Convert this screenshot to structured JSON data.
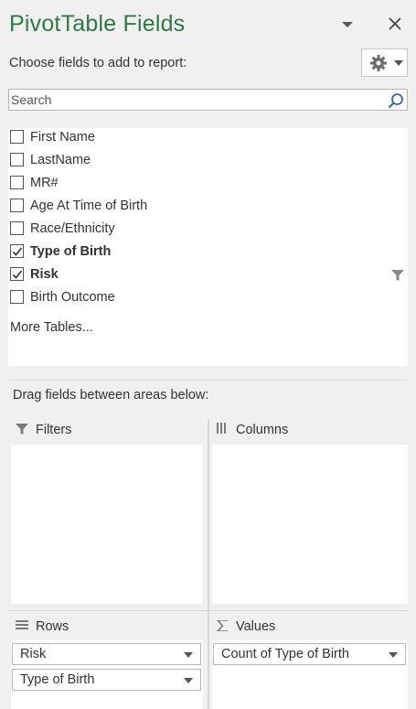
{
  "header": {
    "title": "PivotTable Fields",
    "choose_label": "Choose fields to add to report:"
  },
  "search": {
    "placeholder": "Search"
  },
  "fields": [
    {
      "label": "First Name",
      "checked": false,
      "bold": false,
      "filtered": false
    },
    {
      "label": "LastName",
      "checked": false,
      "bold": false,
      "filtered": false
    },
    {
      "label": "MR#",
      "checked": false,
      "bold": false,
      "filtered": false
    },
    {
      "label": "Age At Time of Birth",
      "checked": false,
      "bold": false,
      "filtered": false
    },
    {
      "label": "Race/Ethnicity",
      "checked": false,
      "bold": false,
      "filtered": false
    },
    {
      "label": "Type of Birth",
      "checked": true,
      "bold": true,
      "filtered": false
    },
    {
      "label": "Risk",
      "checked": true,
      "bold": true,
      "filtered": true
    },
    {
      "label": "Birth Outcome",
      "checked": false,
      "bold": false,
      "filtered": false
    }
  ],
  "more_tables": "More Tables...",
  "drag_label": "Drag fields between areas below:",
  "areas": {
    "filters": {
      "title": "Filters",
      "items": []
    },
    "columns": {
      "title": "Columns",
      "items": []
    },
    "rows": {
      "title": "Rows",
      "items": [
        "Risk",
        "Type of Birth"
      ]
    },
    "values": {
      "title": "Values",
      "items": [
        "Count of Type of Birth"
      ]
    }
  },
  "colors": {
    "title_green": "#2e7a45",
    "panel_bg": "#f0f0f0"
  }
}
